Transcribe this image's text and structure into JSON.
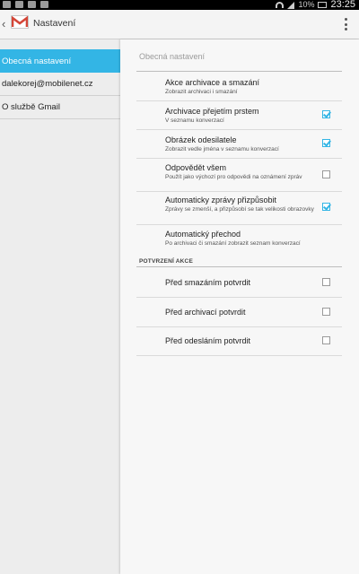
{
  "status_bar": {
    "battery": "10%",
    "time": "23:25"
  },
  "action_bar": {
    "title": "Nastavení"
  },
  "sidebar": {
    "items": [
      {
        "label": "Obecná nastavení",
        "active": true
      },
      {
        "label": "dalekorej@mobilenet.cz",
        "active": false
      },
      {
        "label": "O službě Gmail",
        "active": false
      }
    ]
  },
  "settings": {
    "header": "Obecná nastavení",
    "items": [
      {
        "title": "Akce archivace a smazání",
        "summary": "Zobrazit archivaci i smazání",
        "checkbox": null
      },
      {
        "title": "Archivace přejetím prstem",
        "summary": "V seznamu konverzací",
        "checkbox": true
      },
      {
        "title": "Obrázek odesilatele",
        "summary": "Zobrazit vedle jména v seznamu konverzací",
        "checkbox": true
      },
      {
        "title": "Odpovědět všem",
        "summary": "Použít jako výchozí pro odpovědi na oznámení zpráv",
        "checkbox": false
      },
      {
        "title": "Automaticky zprávy přizpůsobit",
        "summary": "Zprávy se zmenší, a přizpůsobí se tak velikosti obrazovky",
        "checkbox": true
      },
      {
        "title": "Automatický přechod",
        "summary": "Po archivaci či smazání zobrazit seznam konverzací",
        "checkbox": null
      }
    ],
    "confirm_category": "POTVRZENÍ AKCE",
    "confirm_items": [
      {
        "title": "Před smazáním potvrdit",
        "checkbox": false
      },
      {
        "title": "Před archivací potvrdit",
        "checkbox": false
      },
      {
        "title": "Před odesláním potvrdit",
        "checkbox": false
      }
    ]
  },
  "colors": {
    "accent": "#33b5e5",
    "gmail_red": "#d44638"
  }
}
